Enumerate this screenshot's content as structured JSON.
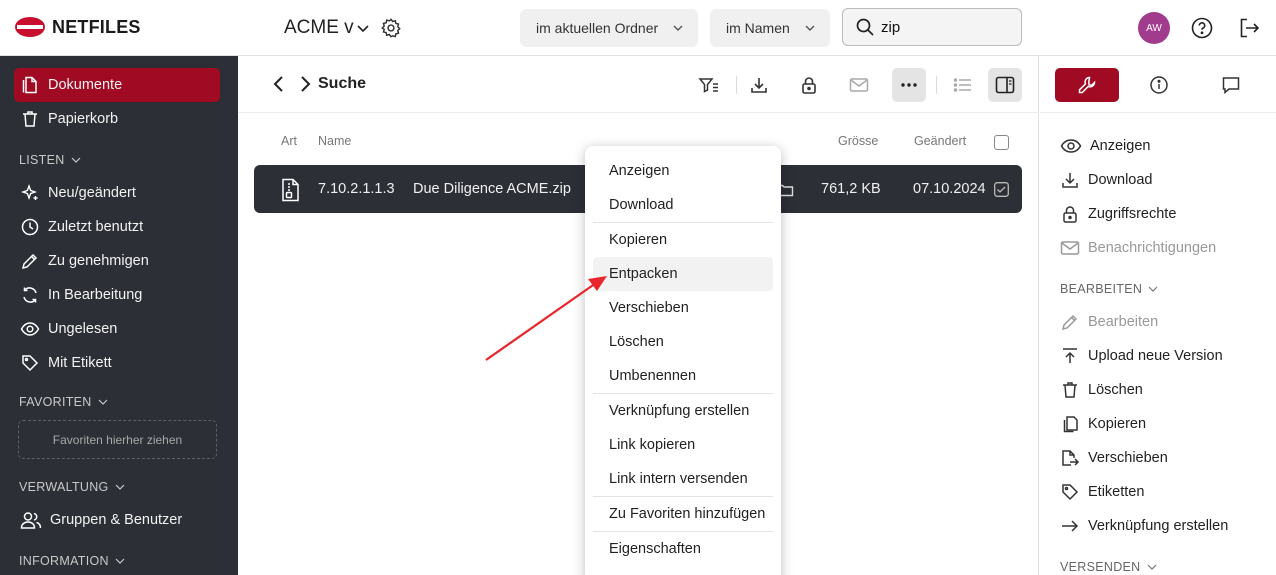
{
  "topbar": {
    "logo_text": "NETFILES",
    "workspace_title": "ACME v",
    "scope_select": "im aktuellen Ordner",
    "field_select": "im Namen",
    "search_value": "zip",
    "avatar_initials": "AW"
  },
  "sidebar": {
    "items": [
      {
        "label": "Dokumente",
        "icon": "document-icon"
      },
      {
        "label": "Papierkorb",
        "icon": "trash-icon"
      }
    ],
    "sections": {
      "lists": "LISTEN",
      "favorites": "FAVORITEN",
      "admin": "VERWALTUNG",
      "info": "INFORMATION"
    },
    "list_items": [
      {
        "label": "Neu/geändert",
        "icon": "sparkle-icon"
      },
      {
        "label": "Zuletzt benutzt",
        "icon": "clock-icon"
      },
      {
        "label": "Zu genehmigen",
        "icon": "pen-icon"
      },
      {
        "label": "In Bearbeitung",
        "icon": "refresh-icon"
      },
      {
        "label": "Ungelesen",
        "icon": "eye-icon"
      },
      {
        "label": "Mit Etikett",
        "icon": "tag-icon"
      }
    ],
    "favorites_placeholder": "Favoriten hierher ziehen",
    "admin_items": [
      {
        "label": "Gruppen & Benutzer",
        "icon": "users-icon"
      }
    ]
  },
  "main": {
    "breadcrumb": "Suche",
    "columns": {
      "type": "Art",
      "name": "Name",
      "size": "Grösse",
      "modified": "Geändert"
    },
    "rows": [
      {
        "number": "7.10.2.1.1.3",
        "name": "Due Diligence ACME.zip",
        "size": "761,2 KB",
        "modified": "07.10.2024",
        "selected": true
      }
    ]
  },
  "context_menu": {
    "items": [
      "Anzeigen",
      "Download",
      "Kopieren",
      "Entpacken",
      "Verschieben",
      "Löschen",
      "Umbenennen",
      "Verknüpfung erstellen",
      "Link kopieren",
      "Link intern versenden",
      "Zu Favoriten hinzufügen",
      "Eigenschaften"
    ],
    "hovered": "Entpacken"
  },
  "right_panel": {
    "actions": [
      {
        "label": "Anzeigen",
        "icon": "eye-icon",
        "disabled": false
      },
      {
        "label": "Download",
        "icon": "download-icon",
        "disabled": false
      },
      {
        "label": "Zugriffsrechte",
        "icon": "lock-icon",
        "disabled": false
      },
      {
        "label": "Benachrichtigungen",
        "icon": "mail-icon",
        "disabled": true
      }
    ],
    "edit_section": "BEARBEITEN",
    "edit_actions": [
      {
        "label": "Bearbeiten",
        "icon": "pencil-icon",
        "disabled": true
      },
      {
        "label": "Upload neue Version",
        "icon": "upload-icon",
        "disabled": false
      },
      {
        "label": "Löschen",
        "icon": "trash-icon",
        "disabled": false
      },
      {
        "label": "Kopieren",
        "icon": "copy-icon",
        "disabled": false
      },
      {
        "label": "Verschieben",
        "icon": "move-icon",
        "disabled": false
      },
      {
        "label": "Etiketten",
        "icon": "tag-icon",
        "disabled": false
      },
      {
        "label": "Verknüpfung erstellen",
        "icon": "arrow-right-icon",
        "disabled": false
      }
    ],
    "send_section": "VERSENDEN"
  },
  "colors": {
    "brand_red": "#a00a22",
    "sidebar_bg": "#2c2f36",
    "annotation_arrow": "#e8262b",
    "avatar_bg": "#a13b8d"
  }
}
